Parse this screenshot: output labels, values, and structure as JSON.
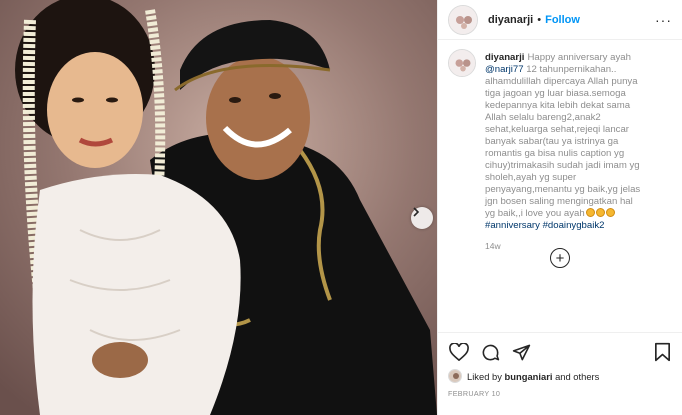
{
  "post": {
    "username": "diyanarji",
    "separator": "•",
    "follow_label": "Follow",
    "more_label": "···",
    "caption_username": "diyanarji",
    "caption_lines": [
      "Happy anniversary ayah",
      "12 tahunpernikahan..",
      "alhamdulillah dipercaya Allah punya",
      "tiga jagoan yg luar biasa.semoga",
      "kedepannya kita lebih dekat sama",
      "Allah selalu bareng2,anak2",
      "sehat,keluarga sehat,rejeqi lancar",
      "banyak sabar(tau ya istrinya ga",
      "romantis ga bisa nulis caption yg",
      "cihuy)trimakasih sudah jadi imam yg",
      "sholeh,ayah yg super",
      "penyayang,menantu yg baik,yg jelas",
      "jgn bosen saling mengingatkan hal",
      "yg baik,,i love you ayah"
    ],
    "mention": "@narji77",
    "hashtags": "#anniversary #doainygbaik2",
    "time_ago": "14w",
    "load_more_label": "+",
    "liked_by_prefix": "Liked by",
    "liked_by_user": "bunganiari",
    "liked_by_suffix": "and others",
    "date": "FEBRUARY 10"
  },
  "icons": {
    "next": "chevron-right-icon",
    "like": "heart-icon",
    "comment": "comment-icon",
    "share": "paper-plane-icon",
    "save": "bookmark-icon",
    "more": "more-options-icon",
    "load_more": "plus-circle-icon"
  },
  "colors": {
    "link": "#00376b",
    "follow": "#0095f6",
    "muted": "#8e8e8e",
    "border": "#efefef"
  }
}
